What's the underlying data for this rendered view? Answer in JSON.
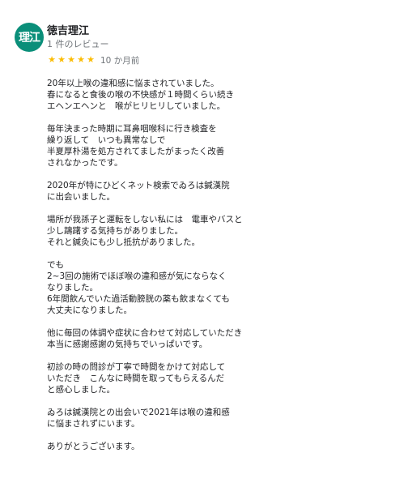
{
  "reviewer": {
    "avatar_text": "理江",
    "avatar_color": "#0b8f7a",
    "name": "徳吉理江",
    "review_count": "1 件のレビュー"
  },
  "rating": {
    "stars": 5,
    "star_color": "#fbbc04",
    "date": "10 か月前"
  },
  "review": {
    "paragraphs": [
      "20年以上喉の違和感に悩まされていました。\n春になると食後の喉の不快感が１時間くらい続き\nエヘンエヘンと　喉がヒリヒリしていました。",
      "毎年決まった時期に耳鼻咽喉科に行き検査を\n繰り返して　いつも異常なしで\n半夏厚朴湯を処方されてましたがまったく改善\nされなかったです。",
      "2020年が特にひどくネット検索でゐろは鍼漢院\nに出会いました。",
      "場所が我孫子と運転をしない私には　電車やバスと\n少し躊躇する気持ちがありました。\nそれと鍼灸にも少し抵抗がありました。",
      "でも\n2~3回の施術でほぼ喉の違和感が気にならなく\nなりました。\n6年間飲んでいた過活動膀胱の薬も飲まなくても\n大丈夫になりました。",
      "他に毎回の体調や症状に合わせて対応していただき\n本当に感謝感謝の気持ちでいっぱいです。",
      "初診の時の問診が丁寧で時間をかけて対応して\nいただき　こんなに時間を取ってもらえるんだ\nと感心しました。",
      "ゐろは鍼漢院との出会いで2021年は喉の違和感\nに悩まされずにいます。",
      "ありがとうございます。"
    ]
  }
}
